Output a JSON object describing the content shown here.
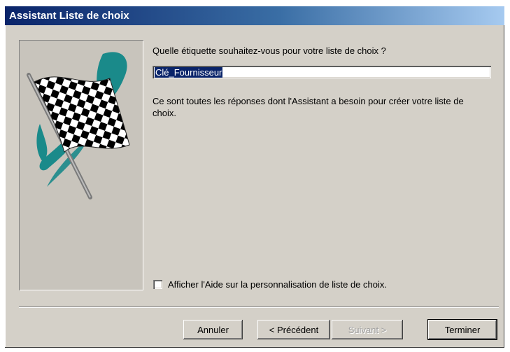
{
  "window": {
    "title": "Assistant Liste de choix"
  },
  "wizard": {
    "question": "Quelle étiquette souhaitez-vous pour votre liste de choix ?",
    "label_value": "Clé_Fournisseur",
    "info": "Ce sont toutes les réponses dont l'Assistant a besoin pour créer votre liste de choix.",
    "help_checkbox": {
      "label": "Afficher l'Aide sur la personnalisation de liste de choix.",
      "checked": false
    }
  },
  "buttons": {
    "cancel": "Annuler",
    "previous": "< Précédent",
    "next": "Suivant >",
    "finish": "Terminer"
  },
  "colors": {
    "titlebar": "#0a246a",
    "dialog_bg": "#d4d0c8",
    "teal_art": "#1a8a8a"
  },
  "icons": {
    "art": "checkered-flag-icon"
  }
}
